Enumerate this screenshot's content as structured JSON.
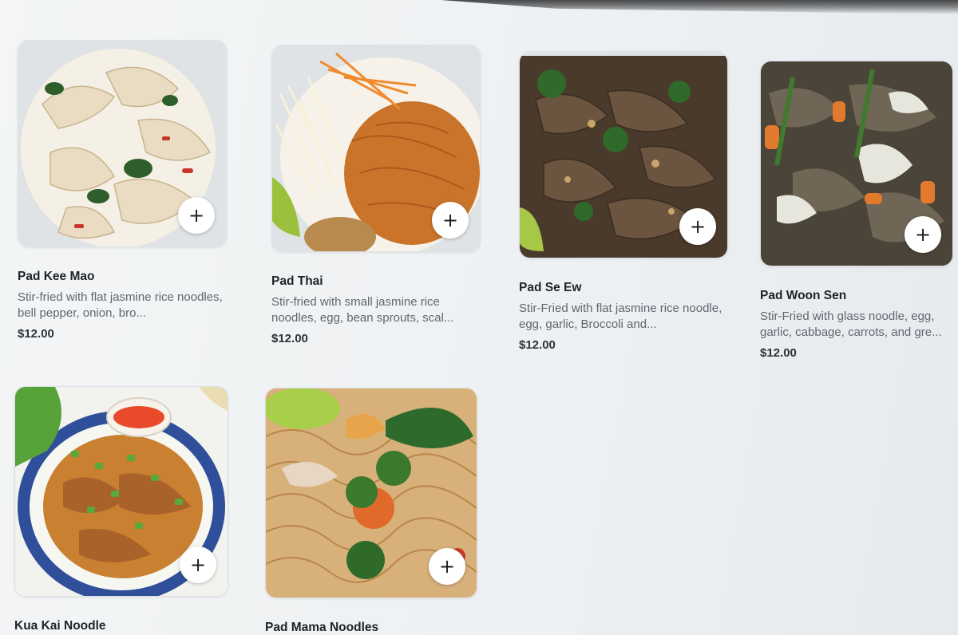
{
  "menu": {
    "items": [
      {
        "name": "Pad Kee Mao",
        "description": "Stir-fried with flat jasmine rice noodles, bell pepper, onion, bro...",
        "price": "$12.00",
        "add_icon": "plus-icon"
      },
      {
        "name": "Pad Thai",
        "description": "Stir-fried with small jasmine rice noodles, egg, bean sprouts, scal...",
        "price": "$12.00",
        "add_icon": "plus-icon"
      },
      {
        "name": "Pad Se Ew",
        "description": "Stir-Fried with flat jasmine rice noodle, egg, garlic, Broccoli and...",
        "price": "$12.00",
        "add_icon": "plus-icon"
      },
      {
        "name": "Pad Woon Sen",
        "description": "Stir-Fried with glass noodle, egg, garlic, cabbage, carrots, and gre...",
        "price": "$12.00",
        "add_icon": "plus-icon"
      },
      {
        "name": "Kua Kai Noodle",
        "add_icon": "plus-icon"
      },
      {
        "name": "Pad Mama Noodles",
        "add_icon": "plus-icon"
      }
    ],
    "colors": {
      "background": "#eef1f3",
      "title_text": "#1f2326",
      "description_text": "#5f6770",
      "add_button": "#ffffff"
    }
  }
}
